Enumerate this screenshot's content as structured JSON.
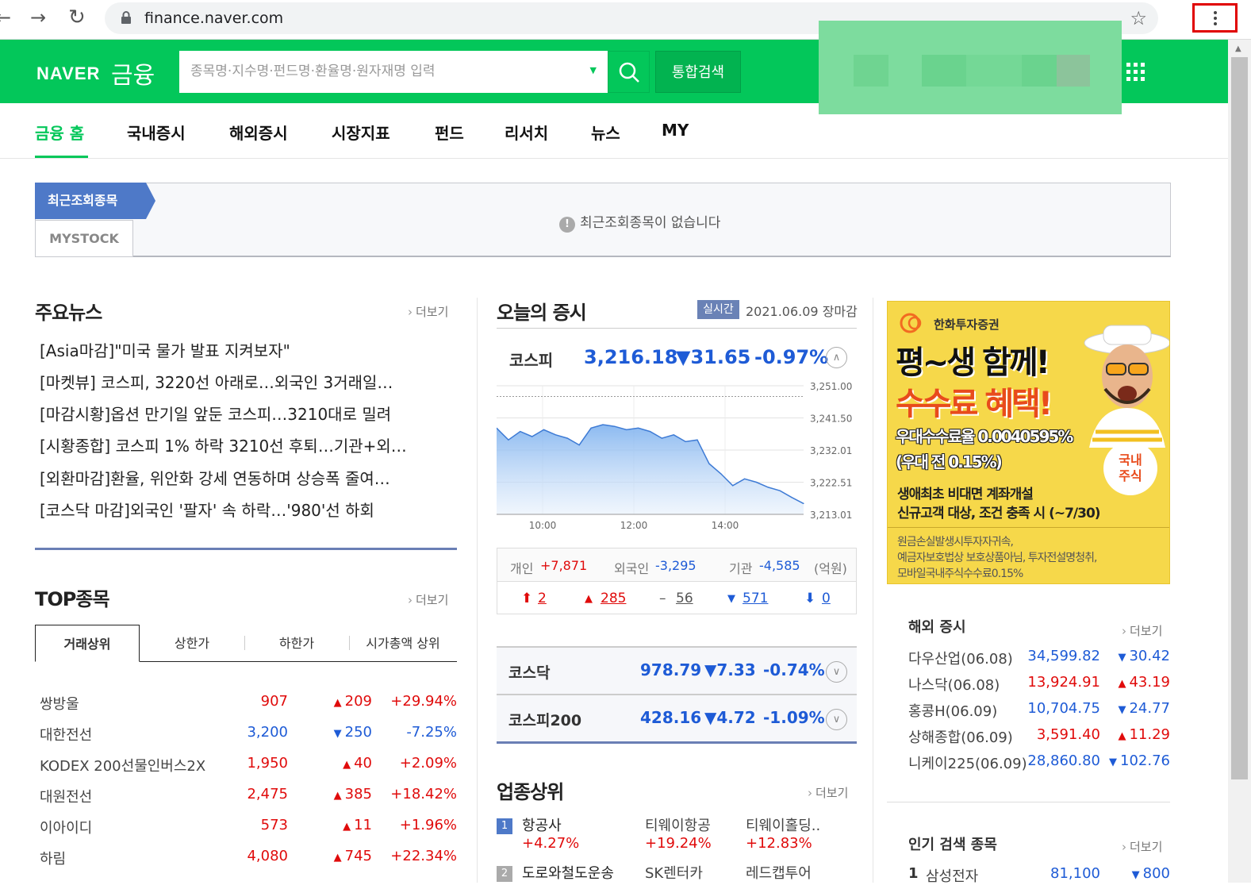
{
  "browser": {
    "url": "finance.naver.com",
    "back_glyph": "←",
    "forward_glyph": "→",
    "reload_glyph": "↻",
    "star_glyph": "☆"
  },
  "header": {
    "logo_naver": "NAVER",
    "logo_finance": "금융",
    "search_placeholder": "종목명·지수명·펀드명·환율명·원자재명 입력",
    "total_search_label": "통합검색"
  },
  "tabs": [
    "금융 홈",
    "국내증시",
    "해외증시",
    "시장지표",
    "펀드",
    "리서치",
    "뉴스",
    "MY"
  ],
  "recent": {
    "tab_label": "최근조회종목",
    "mystock_label": "MYSTOCK",
    "empty_message": "최근조회종목이 없습니다"
  },
  "news": {
    "title": "주요뉴스",
    "more": "더보기",
    "items": [
      "[Asia마감]\"미국 물가 발표 지켜보자\"",
      "[마켓뷰] 코스피, 3220선 아래로…외국인 3거래일…",
      "[마감시황]옵션 만기일 앞둔 코스피…3210대로 밀려",
      "[시황종합] 코스피 1% 하락 3210선 후퇴…기관+외…",
      "[외환마감]환율, 위안화 강세 연동하며 상승폭 줄여…",
      "[코스닥 마감]외국인 '팔자' 속 하락…'980'선 하회"
    ]
  },
  "top_stocks": {
    "title": "TOP종목",
    "more": "더보기",
    "tabs": [
      "거래상위",
      "상한가",
      "하한가",
      "시가총액 상위"
    ],
    "rows": [
      {
        "name": "쌍방울",
        "price": "907",
        "change": "209",
        "dir": "up",
        "rate": "+29.94%"
      },
      {
        "name": "대한전선",
        "price": "3,200",
        "change": "250",
        "dir": "down",
        "rate": "-7.25%"
      },
      {
        "name": "KODEX 200선물인버스2X",
        "price": "1,950",
        "change": "40",
        "dir": "up",
        "rate": "+2.09%"
      },
      {
        "name": "대원전선",
        "price": "2,475",
        "change": "385",
        "dir": "up",
        "rate": "+18.42%"
      },
      {
        "name": "이아이디",
        "price": "573",
        "change": "11",
        "dir": "up",
        "rate": "+1.96%"
      },
      {
        "name": "하림",
        "price": "4,080",
        "change": "745",
        "dir": "up",
        "rate": "+22.34%"
      }
    ]
  },
  "market": {
    "title": "오늘의 증시",
    "realtime_badge": "실시간",
    "date": "2021.06.09 장마감",
    "kospi": {
      "label": "코스피",
      "value": "3,216.18",
      "change": "▼31.65",
      "rate": "-0.97%"
    },
    "investors": {
      "individual_label": "개인",
      "individual": "+7,871",
      "foreign_label": "외국인",
      "foreign": "-3,295",
      "institution_label": "기관",
      "institution": "-4,585",
      "unit": "(억원)"
    },
    "breadth": {
      "upper_limit": "2",
      "up": "285",
      "flat": "56",
      "down": "571",
      "lower_limit": "0"
    },
    "kosdaq": {
      "label": "코스닥",
      "value": "978.79",
      "change": "▼7.33",
      "rate": "-0.74%"
    },
    "kospi200": {
      "label": "코스피200",
      "value": "428.16",
      "change": "▼4.72",
      "rate": "-1.09%"
    }
  },
  "chart_data": {
    "type": "area",
    "title": "",
    "xlabel": "",
    "ylabel": "",
    "x_ticks": [
      "10:00",
      "12:00",
      "14:00"
    ],
    "y_ticks": [
      "3,251.00",
      "3,241.50",
      "3,232.01",
      "3,222.51",
      "3,213.01"
    ],
    "ylim": [
      3213.01,
      3251.0
    ],
    "reference_value": 3247.83,
    "x": [
      "09:00",
      "09:15",
      "09:30",
      "09:45",
      "10:00",
      "10:15",
      "10:30",
      "10:45",
      "11:00",
      "11:15",
      "11:30",
      "11:45",
      "12:00",
      "12:15",
      "12:30",
      "12:45",
      "13:00",
      "13:15",
      "13:30",
      "13:45",
      "14:00",
      "14:15",
      "14:30",
      "14:45",
      "15:00",
      "15:15",
      "15:30"
    ],
    "values": [
      3238.5,
      3235.0,
      3237.5,
      3236.0,
      3238.0,
      3236.5,
      3235.5,
      3233.5,
      3238.5,
      3239.5,
      3239.0,
      3238.0,
      3238.5,
      3237.5,
      3235.5,
      3236.5,
      3234.5,
      3235.0,
      3228.0,
      3225.0,
      3221.5,
      3223.5,
      3222.5,
      3221.0,
      3220.0,
      3218.0,
      3216.2
    ],
    "grid": true
  },
  "sectors": {
    "title": "업종상위",
    "more": "더보기",
    "items": [
      {
        "rank": "1",
        "name": "항공사",
        "rate": "+4.27%",
        "stock1": "티웨이항공",
        "stock1_rate": "+19.24%",
        "stock2": "티웨이홀딩..",
        "stock2_rate": "+12.83%"
      },
      {
        "rank": "2",
        "name": "도로와철도운송",
        "stock1": "SK렌터카",
        "stock2": "레드캡투어"
      }
    ]
  },
  "ad": {
    "brand": "한화투자증권",
    "headline1": "평~생 함께!",
    "headline2": "수수료 혜택!",
    "rate_line1": "우대수수료율 0.0040595%",
    "rate_line2": "(우대 전 0.15%)",
    "badge": "국내\n주식",
    "sub1": "생애최초 비대면 계좌개설",
    "sub2": "신규고객 대상, 조건 충족 시 (~7/30)",
    "disclaimer1": "원금손실발생시투자자귀속,",
    "disclaimer2": "예금자보호법상 보호상품아님, 투자전설명청취,",
    "disclaimer3": "모바일국내주식수수료0.15%"
  },
  "world": {
    "title": "해외 증시",
    "more": "더보기",
    "rows": [
      {
        "name": "다우산업(06.08)",
        "price": "34,599.82",
        "change": "30.42",
        "dir": "down"
      },
      {
        "name": "나스닥(06.08)",
        "price": "13,924.91",
        "change": "43.19",
        "dir": "up"
      },
      {
        "name": "홍콩H(06.09)",
        "price": "10,704.75",
        "change": "24.77",
        "dir": "down"
      },
      {
        "name": "상해종합(06.09)",
        "price": "3,591.40",
        "change": "11.29",
        "dir": "up"
      },
      {
        "name": "니케이225(06.09)",
        "price": "28,860.80",
        "change": "102.76",
        "dir": "down"
      }
    ]
  },
  "popular": {
    "title": "인기 검색 종목",
    "more": "더보기",
    "rows": [
      {
        "rank": "1",
        "name": "삼성전자",
        "price": "81,100",
        "change": "800",
        "dir": "down"
      }
    ]
  },
  "colors": {
    "naver_green": "#03c75a",
    "up_red": "#e00b0b",
    "down_blue": "#1e5bd6",
    "accent_navy": "#4e79c8"
  }
}
